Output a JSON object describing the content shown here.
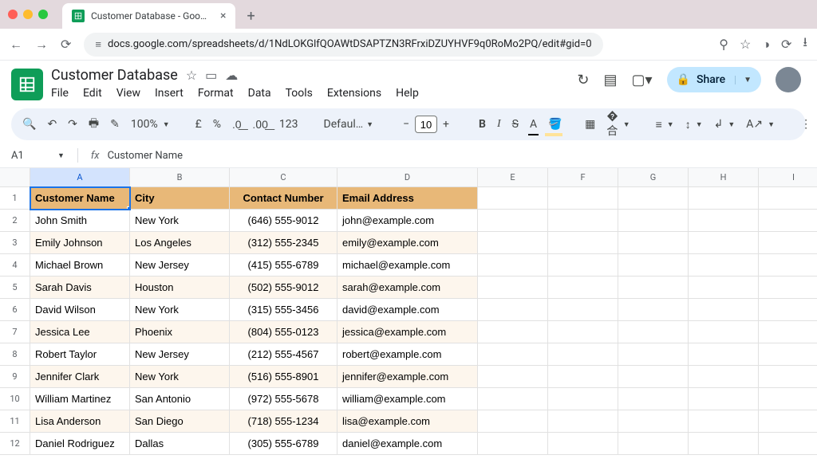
{
  "browser": {
    "tab_title": "Customer Database - Google …",
    "url": "docs.google.com/spreadsheets/d/1NdLOKGlfQOAWtDSAPTZN3RFrxiDZUYHVF9q0RoMo2PQ/edit#gid=0"
  },
  "doc": {
    "title": "Customer Database",
    "menus": [
      "File",
      "Edit",
      "View",
      "Insert",
      "Format",
      "Data",
      "Tools",
      "Extensions",
      "Help"
    ],
    "share_label": "Share"
  },
  "toolbar": {
    "zoom": "100%",
    "currency": "£",
    "percent": "%",
    "dec_dec": ".0←",
    "dec_inc": ".00→",
    "num_123": "123",
    "font": "Defaul…",
    "fontsize": "10",
    "bold": "B",
    "italic": "I",
    "strike": "S",
    "textcolor": "A",
    "fillcolor": "A"
  },
  "fx": {
    "cell": "A1",
    "label": "fx",
    "value": "Customer Name"
  },
  "columns": [
    "A",
    "B",
    "C",
    "D",
    "E",
    "F",
    "G",
    "H",
    "I"
  ],
  "chart_data": {
    "type": "table",
    "headers": [
      "Customer Name",
      "City",
      "Contact Number",
      "Email Address"
    ],
    "rows": [
      [
        "John Smith",
        "New York",
        "(646) 555-9012",
        "john@example.com"
      ],
      [
        "Emily Johnson",
        "Los Angeles",
        "(312) 555-2345",
        "emily@example.com"
      ],
      [
        "Michael Brown",
        "New Jersey",
        "(415) 555-6789",
        "michael@example.com"
      ],
      [
        "Sarah Davis",
        "Houston",
        "(502) 555-9012",
        "sarah@example.com"
      ],
      [
        "David Wilson",
        "New York",
        "(315) 555-3456",
        "david@example.com"
      ],
      [
        "Jessica Lee",
        "Phoenix",
        "(804) 555-0123",
        "jessica@example.com"
      ],
      [
        "Robert Taylor",
        "New Jersey",
        "(212) 555-4567",
        "robert@example.com"
      ],
      [
        "Jennifer Clark",
        "New York",
        "(516) 555-8901",
        "jennifer@example.com"
      ],
      [
        "William Martinez",
        "San Antonio",
        "(972) 555-5678",
        "william@example.com"
      ],
      [
        "Lisa Anderson",
        "San Diego",
        "(718) 555-1234",
        "lisa@example.com"
      ],
      [
        "Daniel Rodriguez",
        "Dallas",
        "(305) 555-6789",
        "daniel@example.com"
      ]
    ]
  }
}
